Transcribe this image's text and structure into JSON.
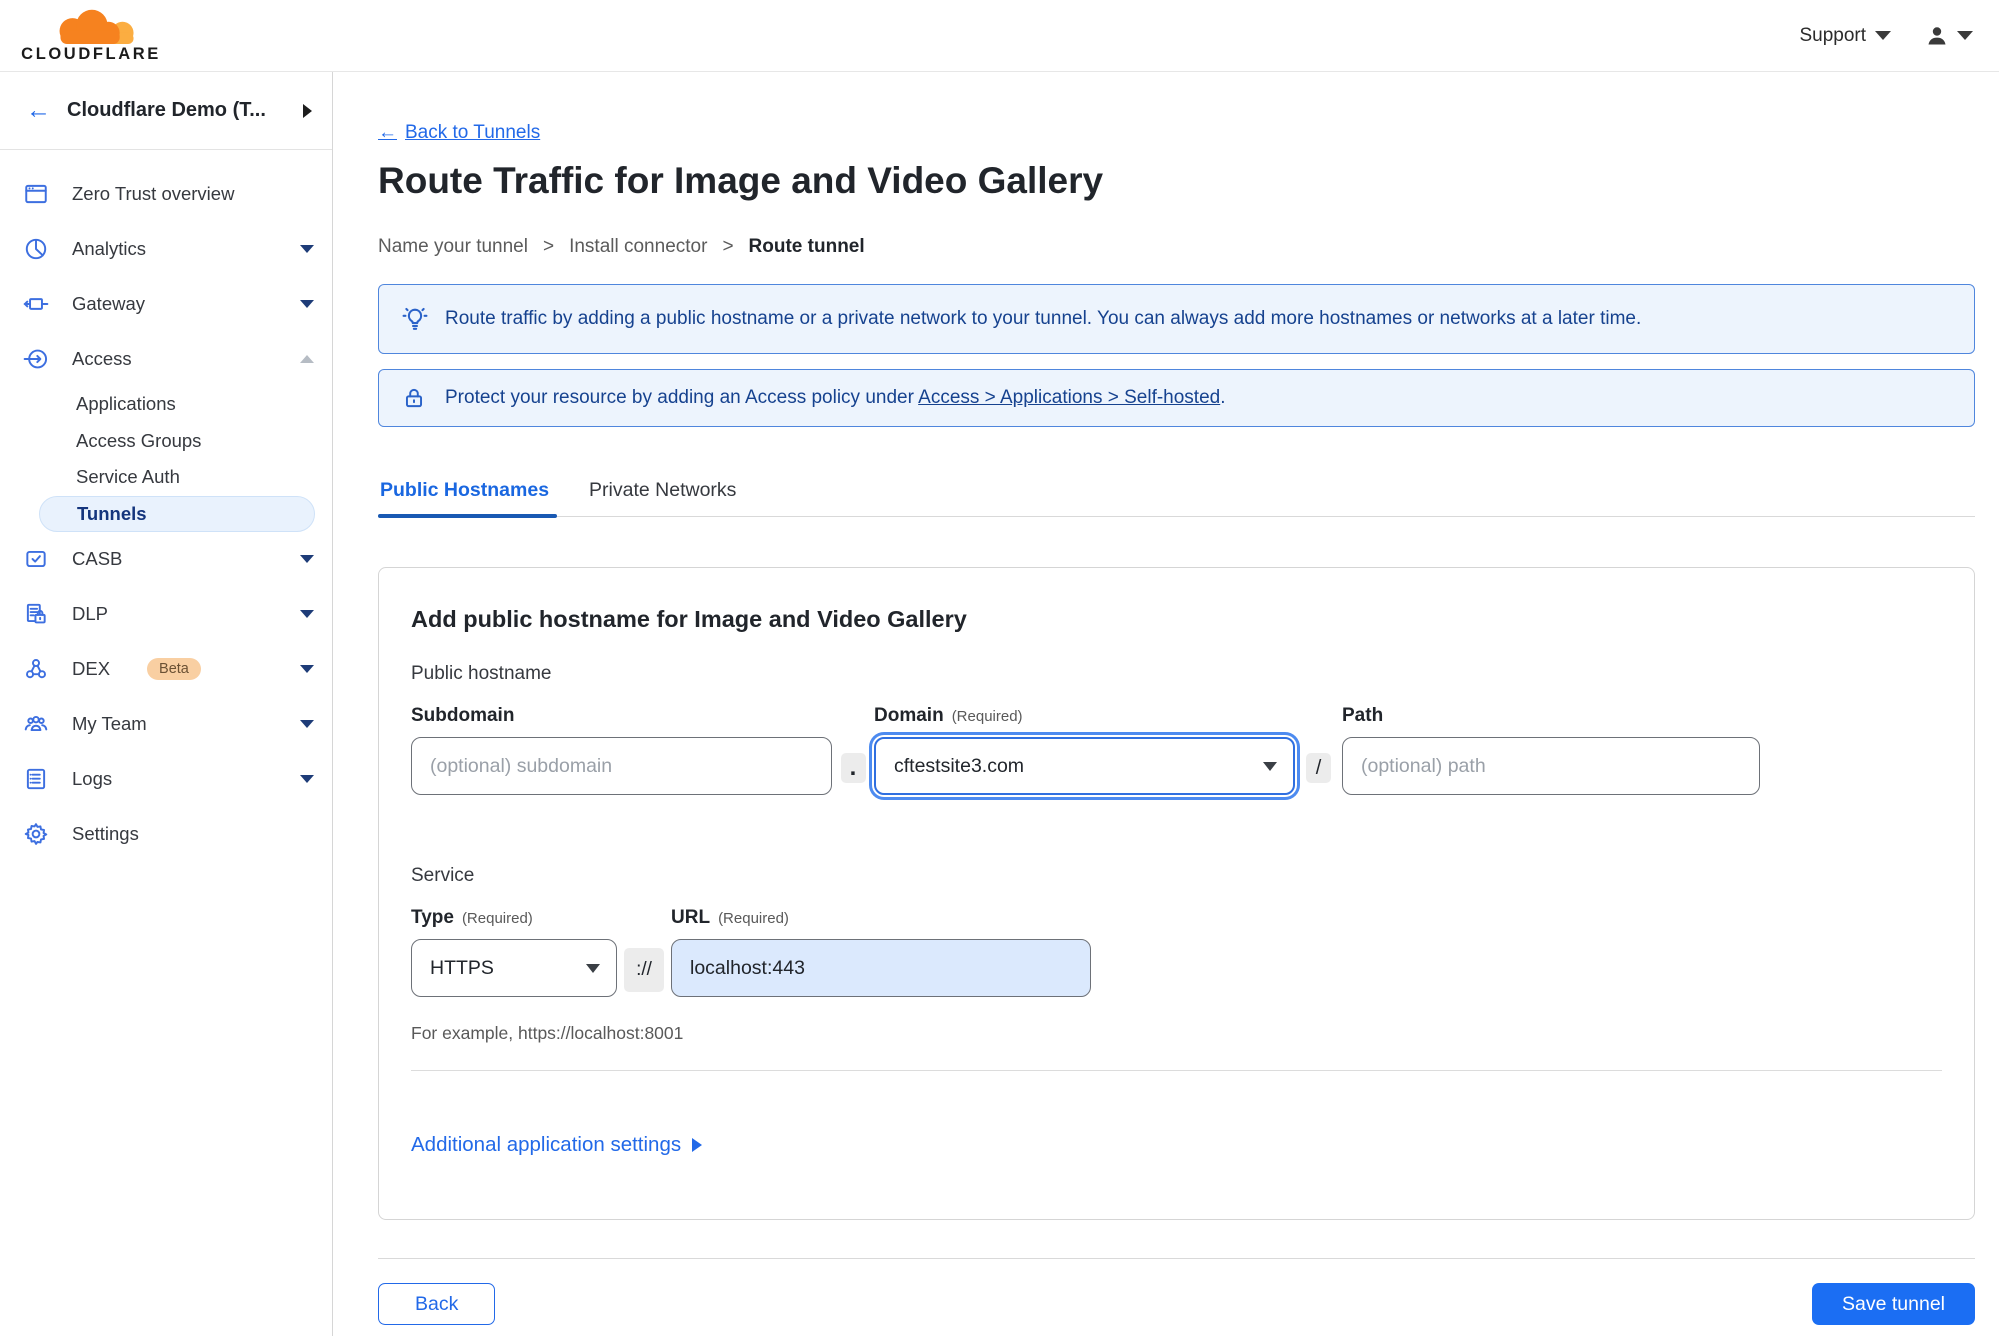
{
  "topbar": {
    "brand": "CLOUDFLARE",
    "support_label": "Support"
  },
  "icons": {
    "back_arrow": "←"
  },
  "sidebar": {
    "account_name": "Cloudflare Demo (T...",
    "items": [
      "Zero Trust overview",
      "Analytics",
      "Gateway",
      "Access",
      "CASB",
      "DLP",
      "DEX",
      "My Team",
      "Logs",
      "Settings"
    ],
    "access_children": [
      "Applications",
      "Access Groups",
      "Service Auth",
      "Tunnels"
    ],
    "active_item": "Tunnels",
    "dex_badge": "Beta"
  },
  "page": {
    "back_link": "Back to Tunnels",
    "title": "Route Traffic for Image and Video Gallery",
    "steps": [
      "Name your tunnel",
      "Install connector",
      "Route tunnel"
    ],
    "step_separator": ">",
    "banner_info": "Route traffic by adding a public hostname or a private network to your tunnel. You can always add more hostnames or networks at a later time.",
    "banner_protect_prefix": "Protect your resource by adding an Access policy under ",
    "banner_protect_link": "Access > Applications > Self-hosted",
    "banner_protect_suffix": ".",
    "tabs": [
      "Public Hostnames",
      "Private Networks"
    ]
  },
  "form": {
    "heading": "Add public hostname for Image and Video Gallery",
    "group_public_hostname": "Public hostname",
    "subdomain_label": "Subdomain",
    "subdomain_placeholder": "(optional) subdomain",
    "dot_separator": ".",
    "domain_label": "Domain",
    "required_hint": "(Required)",
    "domain_value": "cftestsite3.com",
    "slash_separator": "/",
    "path_label": "Path",
    "path_placeholder": "(optional) path",
    "group_service": "Service",
    "type_label": "Type",
    "type_value": "HTTPS",
    "scheme_separator": "://",
    "url_label": "URL",
    "url_value": "localhost:443",
    "example_hint": "For example, https://localhost:8001",
    "additional_settings_label": "Additional application settings"
  },
  "footer": {
    "back_label": "Back",
    "save_label": "Save tunnel"
  },
  "colors": {
    "accent_blue": "#1b6ef3",
    "link_blue": "#2269e8",
    "banner_bg": "#edf4fd",
    "banner_border": "#4f86dd",
    "banner_text": "#16428f",
    "active_pill_bg": "#e9f2fd",
    "beta_badge_bg": "#f9cfa2",
    "brand_orange": "#f6821f",
    "brand_orange_light": "#fbad41"
  }
}
